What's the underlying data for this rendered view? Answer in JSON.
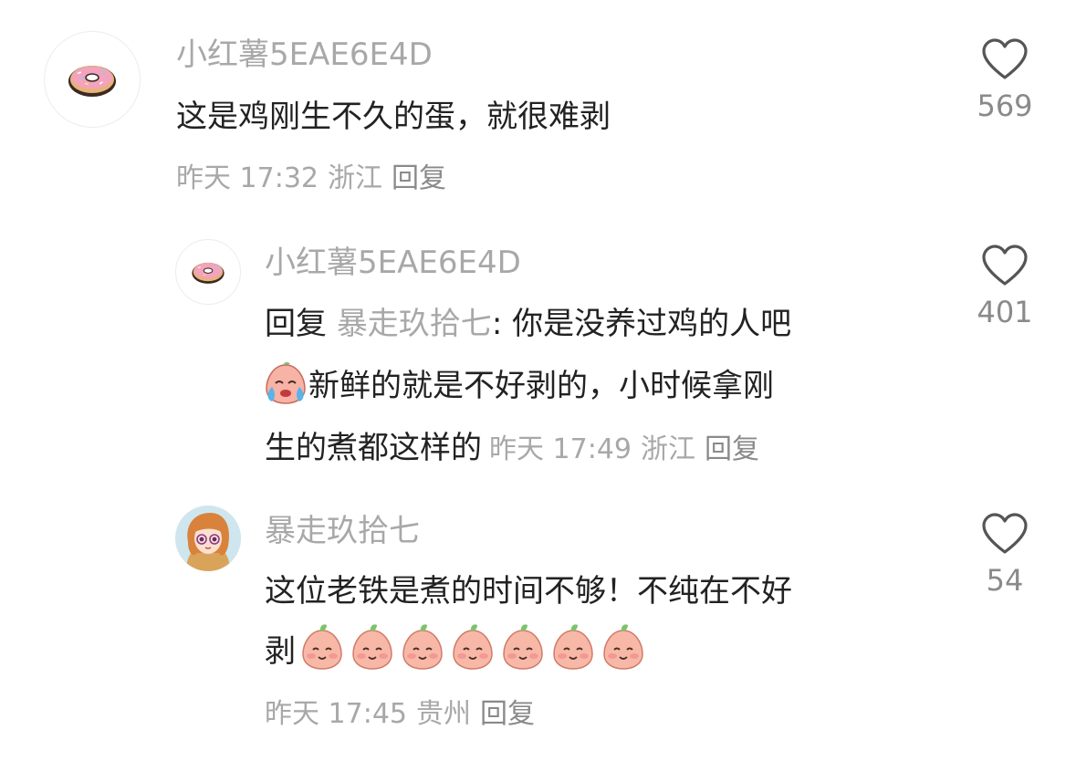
{
  "comments": [
    {
      "username": "小红薯5EAE6E4D",
      "text": "这是鸡刚生不久的蛋，就很难剥",
      "time": "昨天 17:32",
      "location": "浙江",
      "reply": "回复",
      "likes": "569",
      "avatar_icon": "donut-icon"
    },
    {
      "username": "小红薯5EAE6E4D",
      "reply_prefix": "回复",
      "mention": "暴走玖拾七",
      "line1_rest": ": 你是没养过鸡的人吧",
      "line2": "新鲜的就是不好剥的，小时候拿刚",
      "line3": "生的煮都这样的",
      "time": "昨天 17:49",
      "location": "浙江",
      "reply": "回复",
      "likes": "401",
      "avatar_icon": "donut-icon",
      "emoji_icon": "crying-peach-emoji"
    },
    {
      "username": "暴走玖拾七",
      "line1": "这位老铁是煮的时间不够！不纯在不好",
      "line2": "剥",
      "time": "昨天 17:45",
      "location": "贵州",
      "reply": "回复",
      "likes": "54",
      "avatar_icon": "anime-girl-avatar",
      "emoji_icon": "smiling-peach-emoji",
      "emoji_count": 7
    }
  ],
  "colors": {
    "username": "#a8a8a8",
    "text": "#222222",
    "meta": "#a8a8a8",
    "icon": "#555555"
  }
}
